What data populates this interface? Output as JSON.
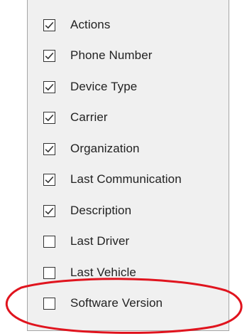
{
  "menu": {
    "items": [
      {
        "label": "Actions",
        "checked": true,
        "name": "menu-item-actions"
      },
      {
        "label": "Phone Number",
        "checked": true,
        "name": "menu-item-phone-number"
      },
      {
        "label": "Device Type",
        "checked": true,
        "name": "menu-item-device-type"
      },
      {
        "label": "Carrier",
        "checked": true,
        "name": "menu-item-carrier"
      },
      {
        "label": "Organization",
        "checked": true,
        "name": "menu-item-organization"
      },
      {
        "label": "Last Communication",
        "checked": true,
        "name": "menu-item-last-communication"
      },
      {
        "label": "Description",
        "checked": true,
        "name": "menu-item-description"
      },
      {
        "label": "Last Driver",
        "checked": false,
        "name": "menu-item-last-driver"
      },
      {
        "label": "Last Vehicle",
        "checked": false,
        "name": "menu-item-last-vehicle"
      },
      {
        "label": "Software Version",
        "checked": false,
        "name": "menu-item-software-version"
      }
    ]
  },
  "annotation": {
    "highlight_color": "#e0141e",
    "highlighted_item": "Software Version"
  },
  "colors": {
    "panel_background": "#f0f0f0",
    "panel_border": "#a6a6a6",
    "checkbox_border": "#333333",
    "checkmark": "#333333",
    "text": "#222222"
  }
}
